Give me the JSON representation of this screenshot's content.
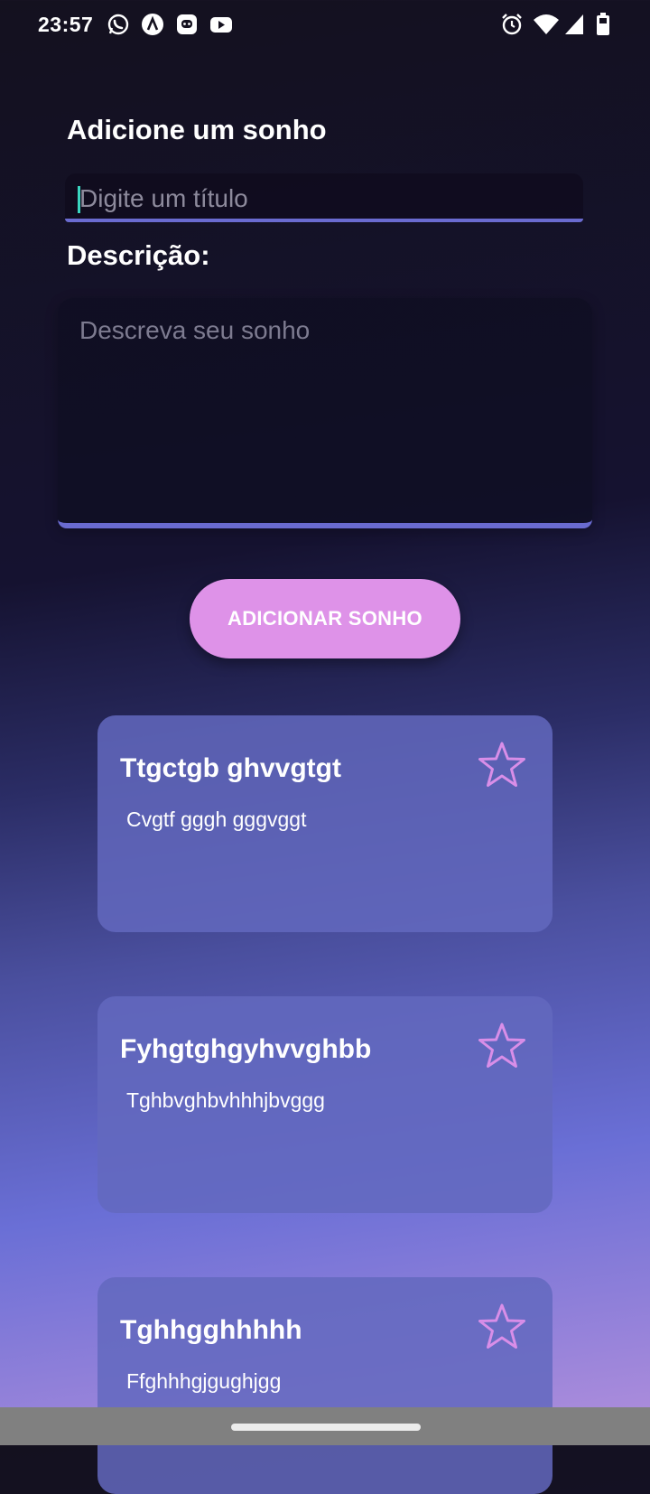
{
  "status_bar": {
    "time": "23:57",
    "left_icons": [
      "whatsapp-icon",
      "app-icon",
      "discord-icon",
      "youtube-icon"
    ],
    "right_icons": [
      "alarm-icon",
      "wifi-icon",
      "signal-icon",
      "battery-icon"
    ]
  },
  "form": {
    "heading": "Adicione um sonho",
    "title_placeholder": "Digite um título",
    "description_label": "Descrição:",
    "description_placeholder": "Descreva seu sonho",
    "add_button_label": "ADICIONAR SONHO"
  },
  "dreams": [
    {
      "title": "Ttgctgb ghvvgtgt",
      "description": "Cvgtf gggh gggvggt",
      "favorite": false
    },
    {
      "title": "Fyhgtghgyhvvghbb",
      "description": "Tghbvghbvhhhjbvggg",
      "favorite": false
    },
    {
      "title": "Tghhgghhhhh",
      "description": "Ffghhhgjgughjgg",
      "favorite": false
    }
  ],
  "colors": {
    "accent": "#de92e8",
    "field_underline": "#6a6bd0",
    "card": "#6368be",
    "star": "#d98ee8",
    "caret": "#3ad6c0"
  }
}
